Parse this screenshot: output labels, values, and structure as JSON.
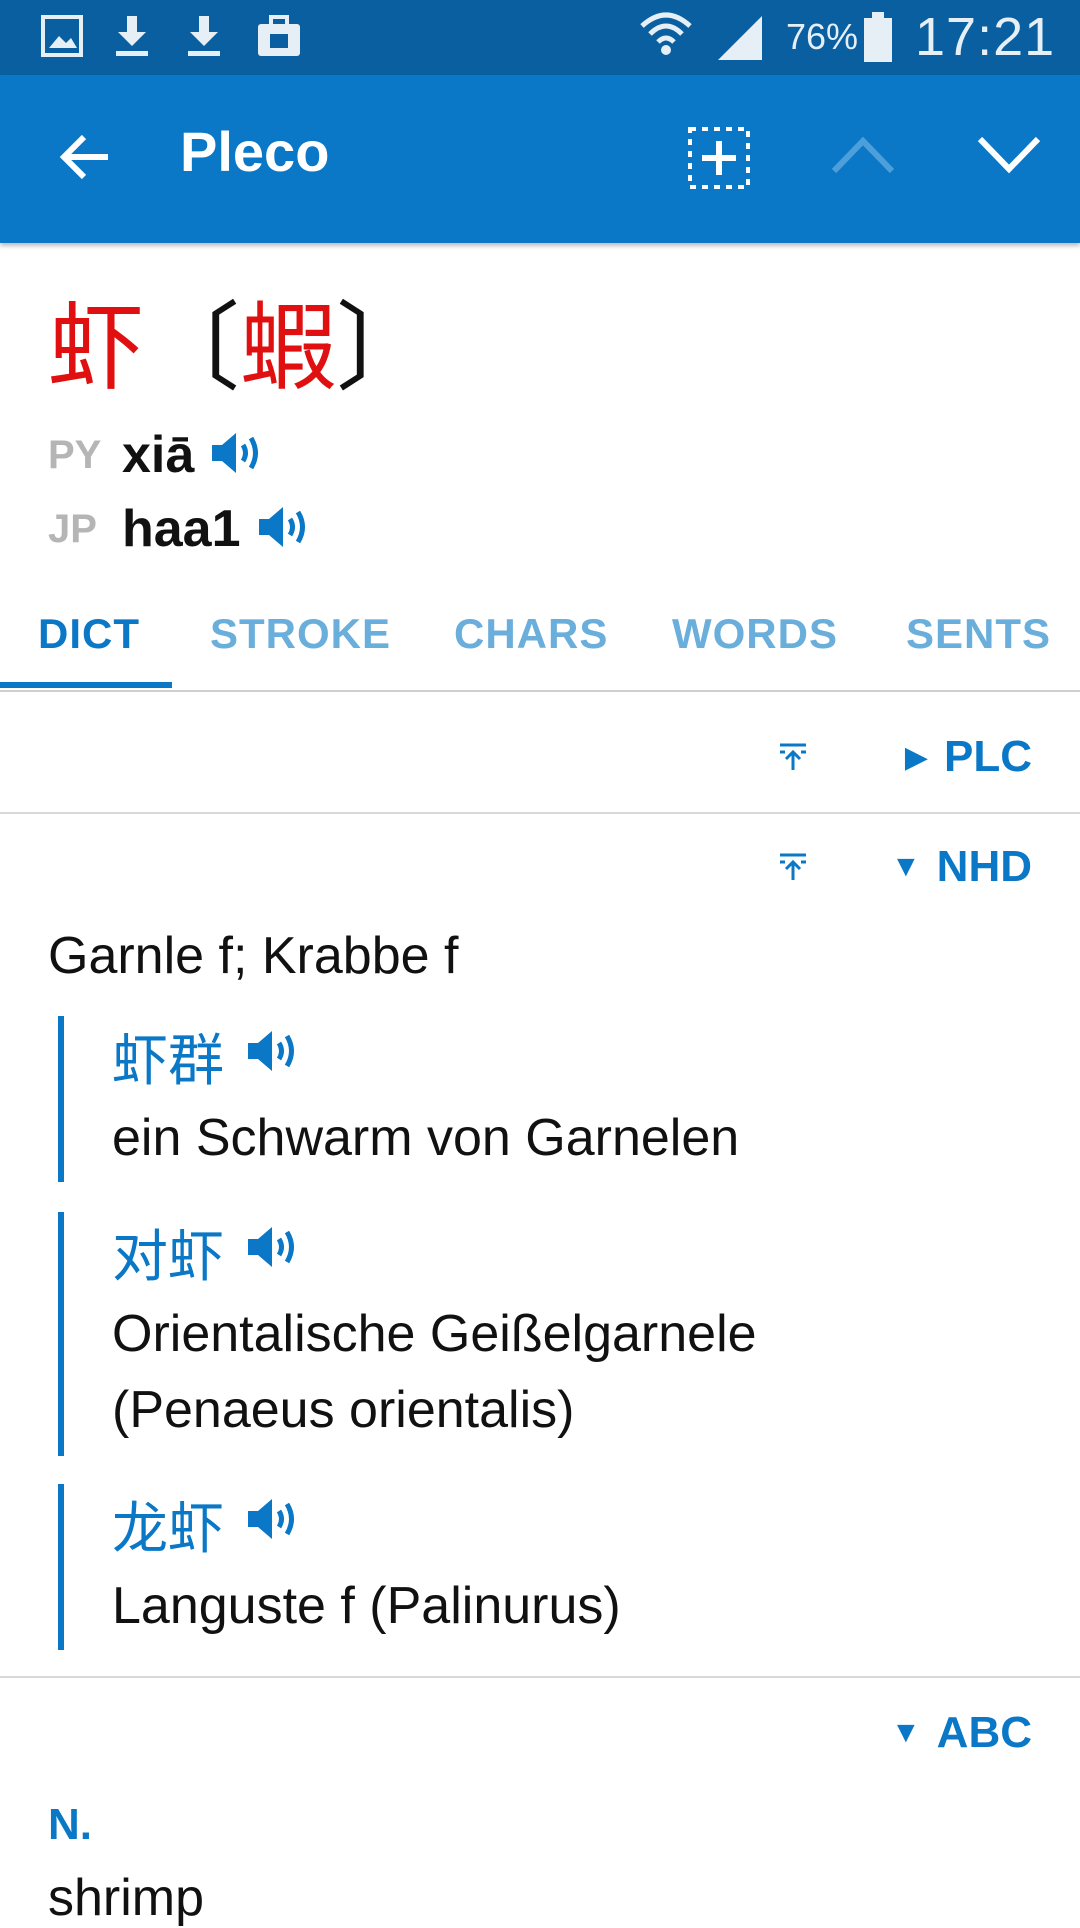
{
  "status_bar": {
    "icons_left": [
      "gallery-icon",
      "download-icon",
      "download-icon",
      "briefcase-icon"
    ],
    "battery_percent": "76%",
    "time": "17:21"
  },
  "toolbar": {
    "title": "Pleco",
    "back_icon": "arrow-left-icon",
    "add_icon": "add-to-flashcards-icon",
    "prev_icon": "chevron-up-icon",
    "next_icon": "chevron-down-icon"
  },
  "entry": {
    "simplified": "虾",
    "traditional": "蝦",
    "bracket_open": "〔",
    "bracket_close": "〕",
    "pinyin_label": "PY",
    "pinyin": "xiā",
    "jyutping_label": "JP",
    "jyutping": "haa1"
  },
  "tabs": [
    "DICT",
    "STROKE",
    "CHARS",
    "WORDS",
    "SENTS"
  ],
  "dictionaries": {
    "plc": {
      "arrow": "▶",
      "name": "PLC"
    },
    "nhd": {
      "arrow": "▼",
      "name": "NHD",
      "definition": "Garnle f; Krabbe f",
      "examples": [
        {
          "hanzi": "虾群",
          "translation": "ein Schwarm von Garnelen"
        },
        {
          "hanzi": "对虾",
          "translation": "Orientalische Geißelgarnele (Penaeus orientalis)"
        },
        {
          "hanzi": "龙虾",
          "translation": "Languste f (Palinurus)"
        }
      ]
    },
    "abc": {
      "arrow": "▼",
      "name": "ABC",
      "pos": "N.",
      "gloss": "shrimp"
    }
  },
  "colors": {
    "status_bar": "#0a5fa0",
    "toolbar": "#0a78c6",
    "accent": "#0a78c6",
    "headword": "#e01010"
  }
}
